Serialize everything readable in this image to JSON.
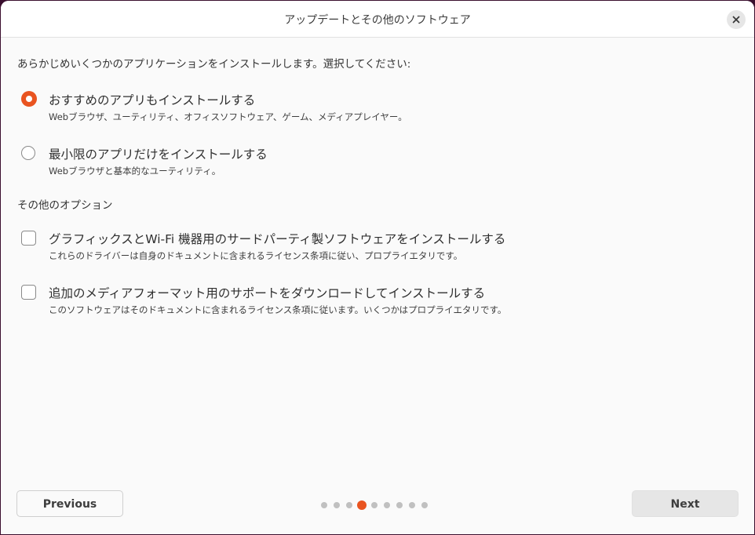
{
  "window": {
    "title": "アップデートとその他のソフトウェア"
  },
  "intro": "あらかじめいくつかのアプリケーションをインストールします。選択してください:",
  "install_options": [
    {
      "label": "おすすめのアプリもインストールする",
      "description": "Webブラウザ、ユーティリティ、オフィスソフトウェア、ゲーム、メディアプレイヤー。",
      "selected": true
    },
    {
      "label": "最小限のアプリだけをインストールする",
      "description": "Webブラウザと基本的なユーティリティ。",
      "selected": false
    }
  ],
  "other_options": {
    "title": "その他のオプション",
    "items": [
      {
        "label": "グラフィックスとWi-Fi 機器用のサードパーティ製ソフトウェアをインストールする",
        "description": "これらのドライバーは自身のドキュメントに含まれるライセンス条項に従い、プロプライエタリです。",
        "checked": false
      },
      {
        "label": "追加のメディアフォーマット用のサポートをダウンロードしてインストールする",
        "description": "このソフトウェアはそのドキュメントに含まれるライセンス条項に従います。いくつかはプロプライエタリです。",
        "checked": false
      }
    ]
  },
  "footer": {
    "previous_label": "Previous",
    "next_label": "Next",
    "pager": {
      "total": 9,
      "current": 4
    }
  },
  "colors": {
    "accent": "#e95420",
    "background": "#fafafa"
  }
}
